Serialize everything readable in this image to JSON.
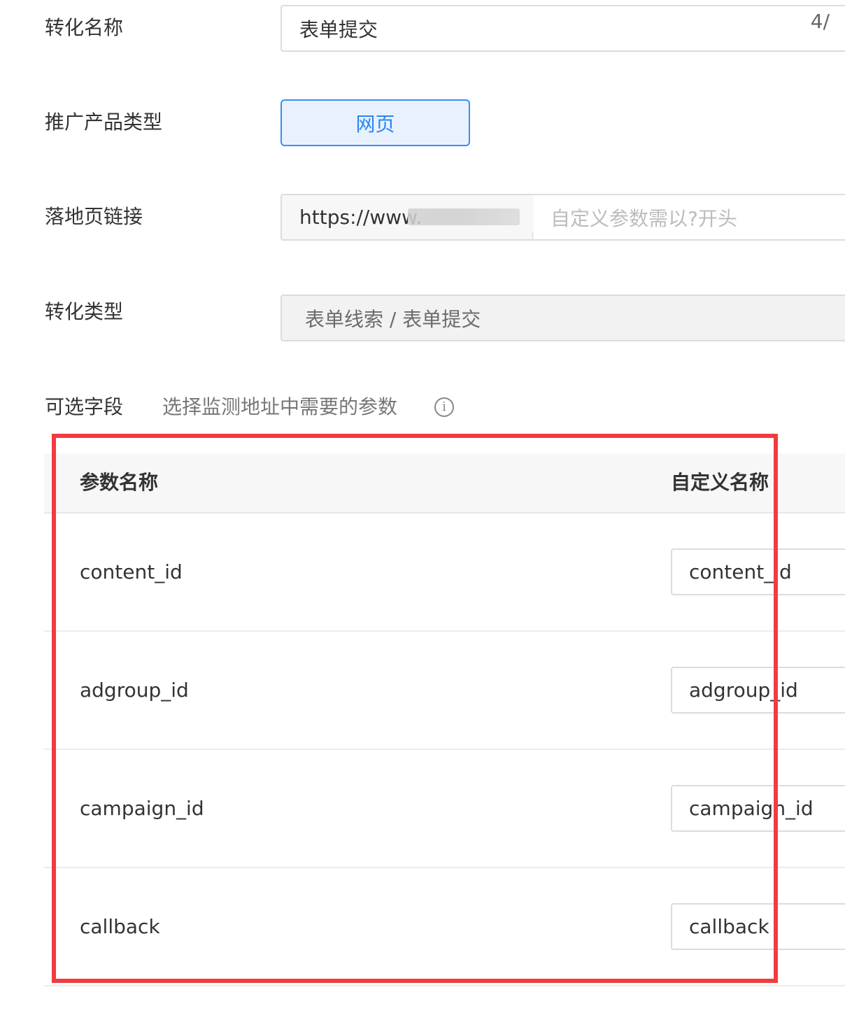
{
  "form": {
    "conversion_name": {
      "label": "转化名称",
      "value": "表单提交",
      "char_count": "4/"
    },
    "product_type": {
      "label": "推广产品类型",
      "option": "网页"
    },
    "landing_page": {
      "label": "落地页链接",
      "url_value": "https://www.",
      "params_placeholder": "自定义参数需以?开头"
    },
    "conversion_type": {
      "label": "转化类型",
      "value": "表单线索 / 表单提交"
    },
    "optional_fields": {
      "label": "可选字段",
      "hint": "选择监测地址中需要的参数",
      "info_icon": "i"
    }
  },
  "table": {
    "headers": [
      "参数名称",
      "自定义名称"
    ],
    "rows": [
      {
        "param": "content_id",
        "custom": "content_id"
      },
      {
        "param": "adgroup_id",
        "custom": "adgroup_id"
      },
      {
        "param": "campaign_id",
        "custom": "campaign_id"
      },
      {
        "param": "callback",
        "custom": "callback"
      }
    ]
  },
  "colors": {
    "accent": "#2d84f2",
    "highlight": "#f23b3f"
  },
  "icons": [
    "info-circle-icon"
  ]
}
